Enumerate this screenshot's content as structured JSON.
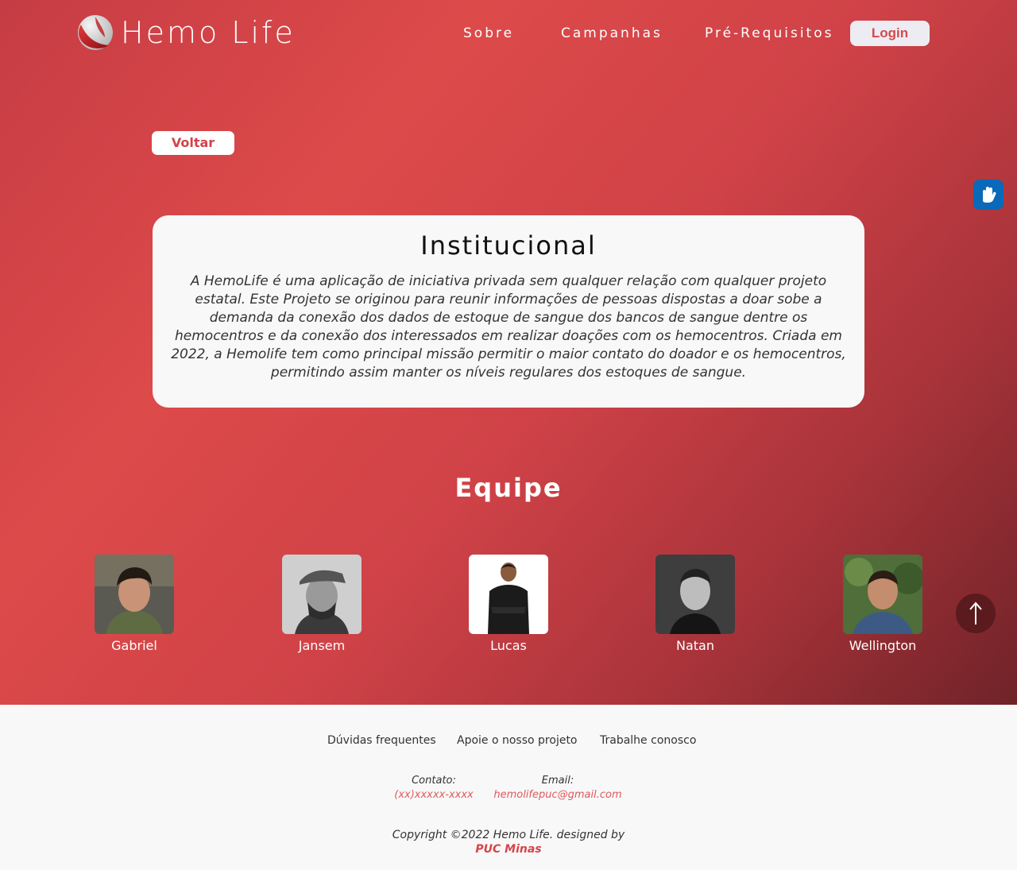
{
  "brand": {
    "name": "Hemo Life"
  },
  "nav": {
    "items": [
      "Sobre",
      "Campanhas",
      "Pré-Requisitos"
    ],
    "login_label": "Login"
  },
  "back_label": "Voltar",
  "institutional": {
    "title": "Institucional",
    "text": "A HemoLife é uma aplicação de iniciativa privada sem qualquer relação com qualquer projeto estatal. Este Projeto se originou para reunir informações de pessoas dispostas a doar sobe a demanda da conexão dos dados de estoque de sangue dos bancos de sangue dentre os hemocentros e da conexão dos interessados em realizar doações com os hemocentros. Criada em 2022, a Hemolife tem como principal missão permitir o maior contato do doador e os hemocentros, permitindo assim manter os níveis regulares dos estoques de sangue."
  },
  "team": {
    "title": "Equipe",
    "members": [
      {
        "name": "Gabriel"
      },
      {
        "name": "Jansem"
      },
      {
        "name": "Lucas"
      },
      {
        "name": "Natan"
      },
      {
        "name": "Wellington"
      }
    ]
  },
  "footer": {
    "links": [
      "Dúvidas frequentes",
      "Apoie o nosso projeto",
      "Trabalhe conosco"
    ],
    "contact_label": "Contato:",
    "contact_value": "(xx)xxxxx-xxxx",
    "email_label": "Email:",
    "email_value": "hemolifepuc@gmail.com",
    "copyright": "Copyright ©2022 Hemo Life. designed by",
    "designer": "PUC Minas"
  },
  "colors": {
    "brand_red": "#dd4a4a",
    "accent_red": "#d44a4e",
    "libras_blue": "#0a69b8",
    "scroll_button": "#5a1a1e"
  },
  "icons": {
    "libras": "hand-sign-icon",
    "scroll_top": "arrow-up-icon"
  }
}
